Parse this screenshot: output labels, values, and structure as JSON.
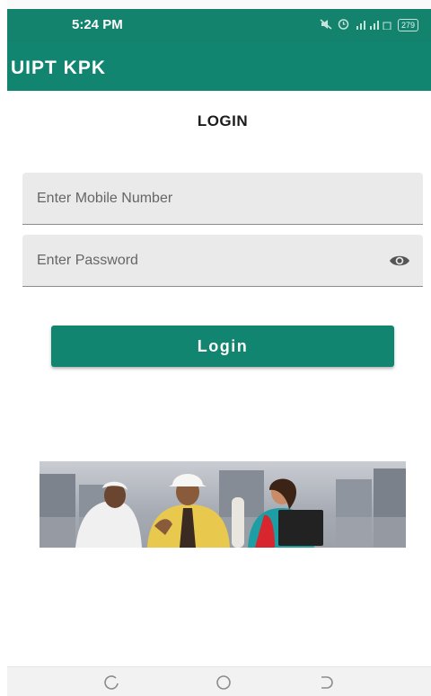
{
  "status_bar": {
    "time": "5:24 PM",
    "battery": "279"
  },
  "app_bar": {
    "title": "UIPT KPK"
  },
  "login": {
    "heading": "LOGIN",
    "mobile_placeholder": "Enter Mobile Number",
    "mobile_value": "",
    "password_placeholder": "Enter Password",
    "password_value": "",
    "button_label": "Login",
    "password_toggle_icon": "eye-icon"
  },
  "banner": {
    "image": "people-banner"
  },
  "nav_bar": {
    "icons": [
      "recent-apps-icon",
      "home-icon",
      "back-icon"
    ]
  },
  "colors": {
    "primary": "#128570",
    "status_bar": "#14836e",
    "field_background": "#eaeaea"
  }
}
